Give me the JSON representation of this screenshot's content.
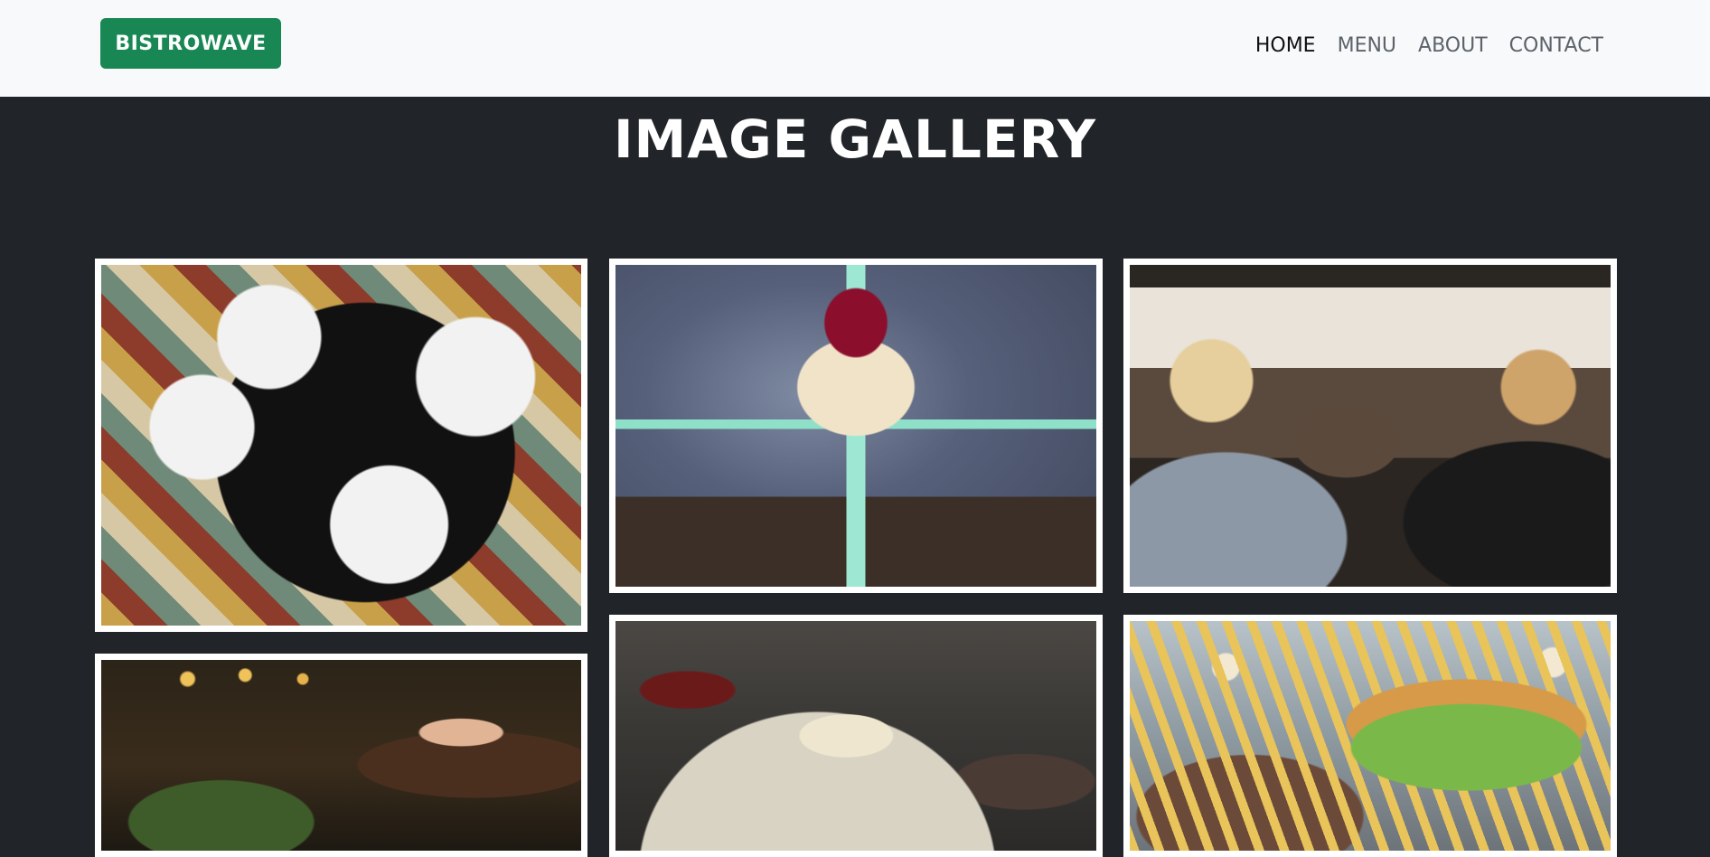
{
  "brand": {
    "label": "BISTROWAVE",
    "color": "#198754"
  },
  "nav": {
    "items": [
      {
        "label": "HOME",
        "active": true
      },
      {
        "label": "MENU",
        "active": false
      },
      {
        "label": "ABOUT",
        "active": false
      },
      {
        "label": "CONTACT",
        "active": false
      }
    ]
  },
  "gallery": {
    "heading": "IMAGE GALLERY",
    "images": [
      {
        "name": "gallery-image-burgers-overhead"
      },
      {
        "name": "gallery-image-flower-cake"
      },
      {
        "name": "gallery-image-crowded-dining"
      },
      {
        "name": "gallery-image-woman-eating"
      },
      {
        "name": "gallery-image-table-setting"
      },
      {
        "name": "gallery-image-burger-fries"
      }
    ]
  },
  "colors": {
    "navbar_bg": "#f8f9fa",
    "page_bg": "#212529",
    "tile_border": "#ffffff"
  }
}
